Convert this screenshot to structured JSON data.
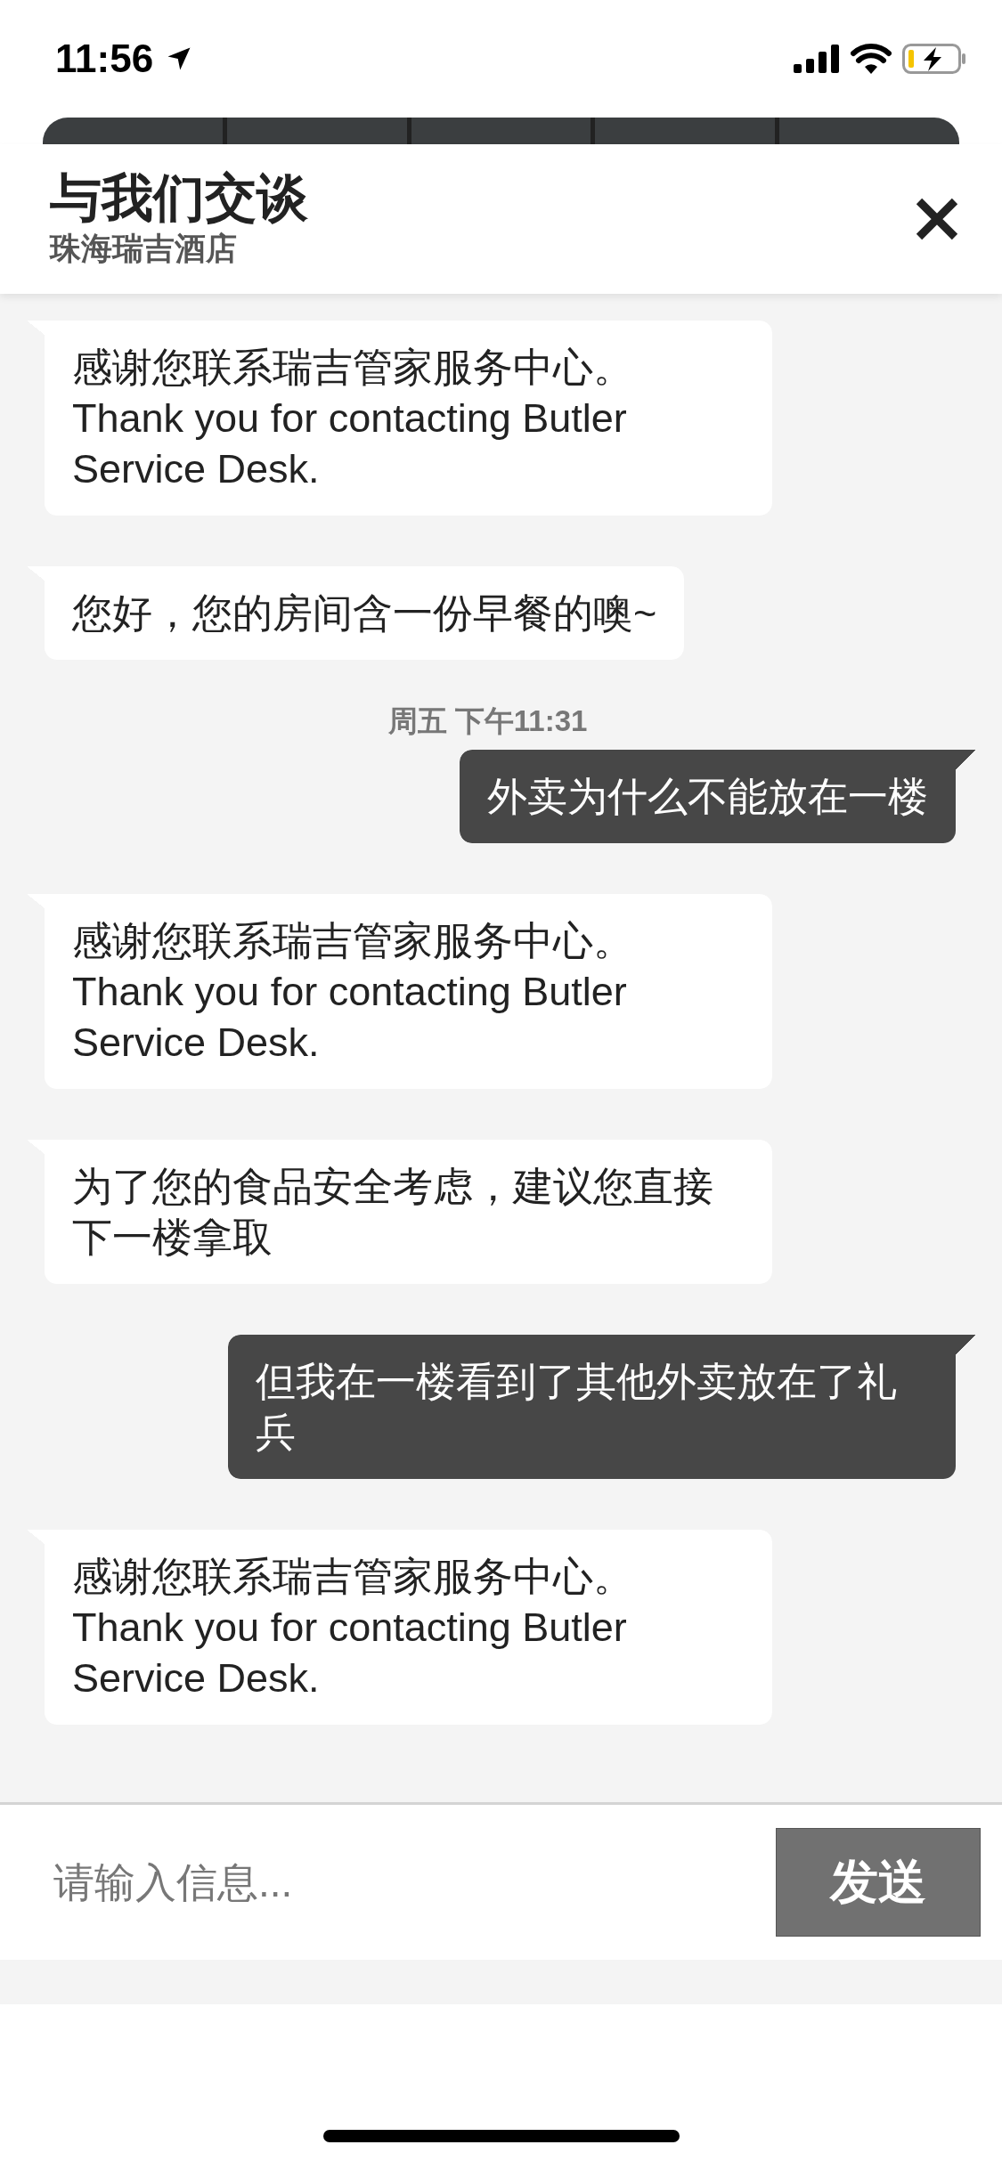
{
  "status_bar": {
    "time": "11:56"
  },
  "header": {
    "title": "与我们交谈",
    "subtitle": "珠海瑞吉酒店"
  },
  "messages": [
    {
      "kind": "incoming",
      "text": "感谢您联系瑞吉管家服务中心。\nThank you for contacting Butler Service Desk."
    },
    {
      "kind": "incoming",
      "text": "您好，您的房间含一份早餐的噢~"
    },
    {
      "kind": "timestamp",
      "text": "周五 下午11:31"
    },
    {
      "kind": "outgoing",
      "text": "外卖为什么不能放在一楼"
    },
    {
      "kind": "incoming",
      "text": "感谢您联系瑞吉管家服务中心。\nThank you for contacting Butler Service Desk."
    },
    {
      "kind": "incoming",
      "text": "为了您的食品安全考虑，建议您直接下一楼拿取"
    },
    {
      "kind": "outgoing",
      "text": "但我在一楼看到了其他外卖放在了礼兵"
    },
    {
      "kind": "incoming",
      "text": "感谢您联系瑞吉管家服务中心。\nThank you for contacting Butler Service Desk."
    }
  ],
  "composer": {
    "placeholder": "请输入信息...",
    "send_label": "发送"
  }
}
